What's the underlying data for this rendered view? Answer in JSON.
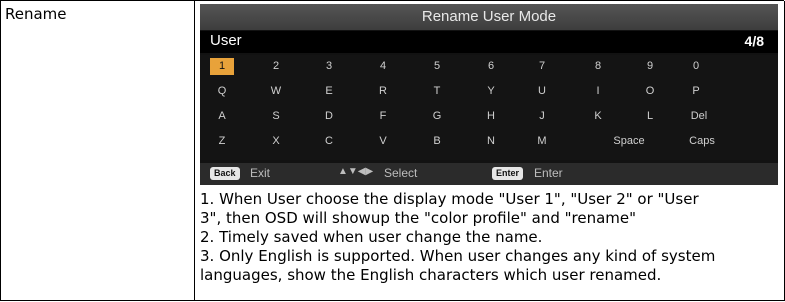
{
  "row_label": "Rename",
  "osd": {
    "title": "Rename User Mode",
    "name_value": "User",
    "counter": "4/8",
    "keys": [
      [
        "1",
        "2",
        "3",
        "4",
        "5",
        "6",
        "7",
        "8",
        "9",
        "0"
      ],
      [
        "Q",
        "W",
        "E",
        "R",
        "T",
        "Y",
        "U",
        "I",
        "O",
        "P"
      ],
      [
        "A",
        "S",
        "D",
        "F",
        "G",
        "H",
        "J",
        "K",
        "L",
        "Del"
      ],
      [
        "Z",
        "X",
        "C",
        "V",
        "B",
        "N",
        "M",
        "Space",
        "Caps"
      ]
    ],
    "selected_key": "1",
    "footer": {
      "back_badge": "Back",
      "exit_label": "Exit",
      "arrows": "▲▼◀▶",
      "select_label": "Select",
      "enter_badge": "Enter",
      "enter_label": "Enter"
    }
  },
  "notes": [
    "1. When User choose the display mode \"User 1\", \"User 2\" or \"User",
    "3\", then OSD will showup the \"color profile\" and \"rename\"",
    "2. Timely saved when user change the name.",
    "3. Only English is supported. When user changes any kind of system",
    "languages, show the English characters which user renamed."
  ]
}
